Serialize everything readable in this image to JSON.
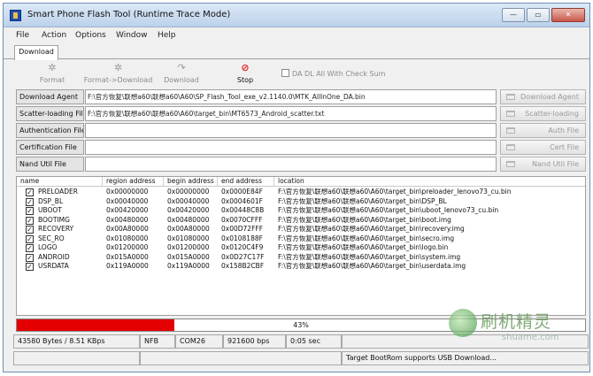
{
  "window": {
    "title": "Smart Phone Flash Tool (Runtime Trace Mode)",
    "controls": {
      "minimize": "—",
      "maximize": "▭",
      "close": "✕"
    }
  },
  "menu": [
    "File",
    "Action",
    "Options",
    "Window",
    "Help"
  ],
  "tabs": [
    "Download"
  ],
  "toolbar": {
    "format": "Format",
    "format_download": "Format->Download",
    "download": "Download",
    "stop": "Stop",
    "da_dl_check": "DA DL All With Check Sum"
  },
  "fields": [
    {
      "label": "Download Agent",
      "value": "F:\\官方恢复\\联想a60\\联想a60\\A60\\SP_Flash_Tool_exe_v2.1140.0\\MTK_AllInOne_DA.bin",
      "button": "Download Agent"
    },
    {
      "label": "Scatter-loading File",
      "value": "F:\\官方恢复\\联想a60\\联想a60\\A60\\target_bin\\MT6573_Android_scatter.txt",
      "button": "Scatter-loading"
    },
    {
      "label": "Authentication File",
      "value": "",
      "button": "Auth File"
    },
    {
      "label": "Certification File",
      "value": "",
      "button": "Cert File"
    },
    {
      "label": "Nand Util File",
      "value": "",
      "button": "Nand Util File"
    }
  ],
  "table": {
    "columns": [
      "name",
      "region address",
      "begin address",
      "end address",
      "location"
    ],
    "rows": [
      {
        "checked": true,
        "name": "PRELOADER",
        "region": "0x00000000",
        "begin": "0x00000000",
        "end": "0x0000E84F",
        "location": "F:\\官方恢复\\联想a60\\联想a60\\A60\\target_bin\\preloader_lenovo73_cu.bin"
      },
      {
        "checked": true,
        "name": "DSP_BL",
        "region": "0x00040000",
        "begin": "0x00040000",
        "end": "0x0004601F",
        "location": "F:\\官方恢复\\联想a60\\联想a60\\A60\\target_bin\\DSP_BL"
      },
      {
        "checked": true,
        "name": "UBOOT",
        "region": "0x00420000",
        "begin": "0x00420000",
        "end": "0x00448C8B",
        "location": "F:\\官方恢复\\联想a60\\联想a60\\A60\\target_bin\\uboot_lenovo73_cu.bin"
      },
      {
        "checked": true,
        "name": "BOOTIMG",
        "region": "0x00480000",
        "begin": "0x00480000",
        "end": "0x0070CFFF",
        "location": "F:\\官方恢复\\联想a60\\联想a60\\A60\\target_bin\\boot.img"
      },
      {
        "checked": true,
        "name": "RECOVERY",
        "region": "0x00A80000",
        "begin": "0x00A80000",
        "end": "0x00D72FFF",
        "location": "F:\\官方恢复\\联想a60\\联想a60\\A60\\target_bin\\recovery.img"
      },
      {
        "checked": true,
        "name": "SEC_RO",
        "region": "0x01080000",
        "begin": "0x01080000",
        "end": "0x0108188F",
        "location": "F:\\官方恢复\\联想a60\\联想a60\\A60\\target_bin\\secro.img"
      },
      {
        "checked": true,
        "name": "LOGO",
        "region": "0x01200000",
        "begin": "0x01200000",
        "end": "0x0120C4F9",
        "location": "F:\\官方恢复\\联想a60\\联想a60\\A60\\target_bin\\logo.bin"
      },
      {
        "checked": true,
        "name": "ANDROID",
        "region": "0x015A0000",
        "begin": "0x015A0000",
        "end": "0x0D27C17F",
        "location": "F:\\官方恢复\\联想a60\\联想a60\\A60\\target_bin\\system.img"
      },
      {
        "checked": true,
        "name": "USRDATA",
        "region": "0x119A0000",
        "begin": "0x119A0000",
        "end": "0x158B2CBF",
        "location": "F:\\官方恢复\\联想a60\\联想a60\\A60\\target_bin\\userdata.img"
      }
    ]
  },
  "progress": {
    "percent": 43,
    "label": "43%",
    "color": "#e40000"
  },
  "status": {
    "rate": "43580 Bytes / 8.51 KBps",
    "nand": "NFB",
    "port": "COM26",
    "baud": "921600 bps",
    "time": "0:05 sec",
    "message": "Target BootRom supports USB Download..."
  },
  "watermark": {
    "text": "刷机精灵",
    "url": "shuame.com"
  }
}
